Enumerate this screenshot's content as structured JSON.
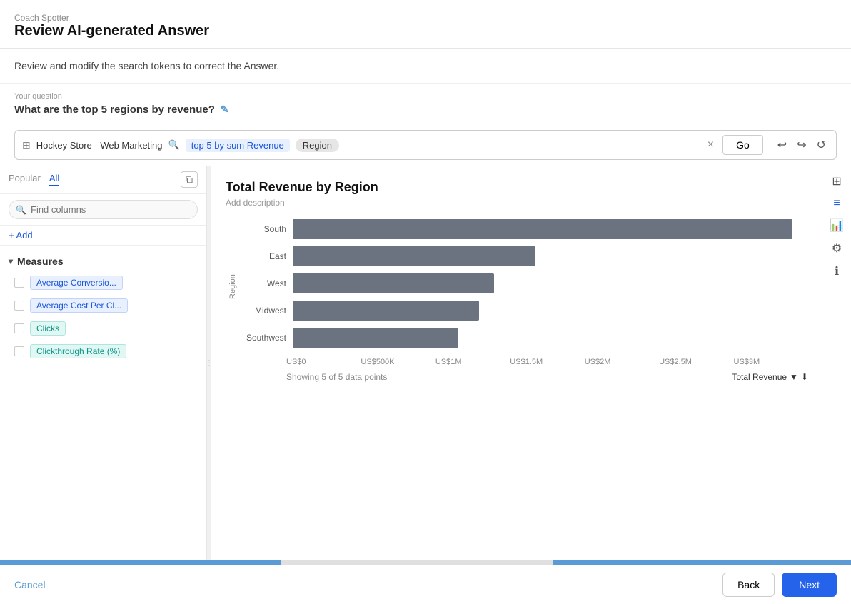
{
  "app": {
    "name": "Coach Spotter",
    "title": "Review AI-generated Answer"
  },
  "page": {
    "description": "Review and modify the search tokens to correct the Answer."
  },
  "question": {
    "label": "Your question",
    "text": "What are the top 5 regions by revenue?",
    "edit_icon": "✎"
  },
  "searchbar": {
    "data_source": "Hockey Store - Web Marketing",
    "token_query": "top 5 by sum Revenue",
    "token_region": "Region",
    "go_label": "Go",
    "clear_icon": "×"
  },
  "left_panel": {
    "tab_popular": "Popular",
    "tab_all": "All",
    "search_placeholder": "Find columns",
    "add_label": "+ Add",
    "measures_header": "Measures",
    "measures": [
      {
        "label": "Average Conversio...",
        "type": "blue"
      },
      {
        "label": "Average Cost Per Cl...",
        "type": "blue"
      },
      {
        "label": "Clicks",
        "type": "teal"
      },
      {
        "label": "Clickthrough Rate (%)",
        "type": "teal"
      }
    ]
  },
  "chart": {
    "title": "Total Revenue by Region",
    "subtitle": "Add description",
    "token_summary": "top by sum Revenue",
    "y_axis_label": "Region",
    "bars": [
      {
        "label": "South",
        "value": 3000000,
        "max": 3100000
      },
      {
        "label": "East",
        "value": 1450000,
        "max": 3100000
      },
      {
        "label": "West",
        "value": 1200000,
        "max": 3100000
      },
      {
        "label": "Midwest",
        "value": 1100000,
        "max": 3100000
      },
      {
        "label": "Southwest",
        "value": 1000000,
        "max": 3100000
      }
    ],
    "x_ticks": [
      "US$0",
      "US$500K",
      "US$1M",
      "US$1.5M",
      "US$2M",
      "US$2.5M",
      "US$3M"
    ],
    "footer_showing": "Showing 5 of 5 data points",
    "sort_label": "Total Revenue",
    "bar_color": "#6b7280"
  },
  "footer": {
    "cancel_label": "Cancel",
    "back_label": "Back",
    "next_label": "Next"
  }
}
